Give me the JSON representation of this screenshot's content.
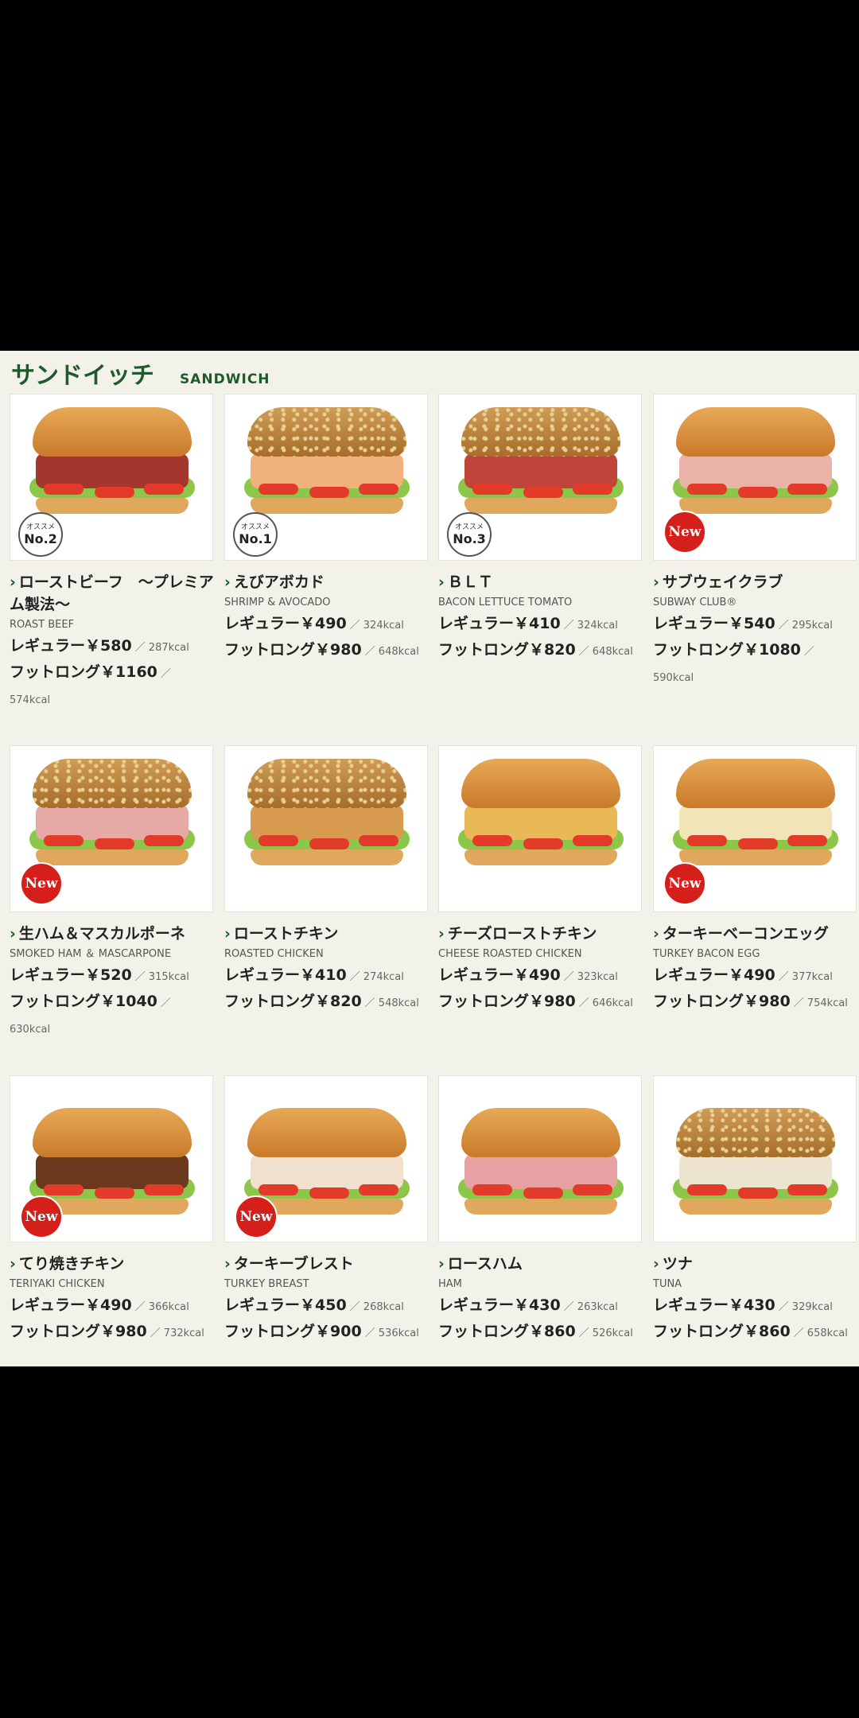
{
  "header": {
    "title_jp": "サンドイッチ",
    "title_en": "SANDWICH"
  },
  "colors": {
    "accent": "#1f5a2c",
    "new_badge": "#d51f1a",
    "background": "#f3f2ea"
  },
  "items": [
    {
      "name": "ローストビーフ　～プレミアム製法～",
      "en": "ROAST BEEF",
      "regular": "レギュラー￥580",
      "regular_cal": "／ 287kcal",
      "footlong": "フットロング￥1160",
      "footlong_cal": "／ 574kcal",
      "badge": "No.2"
    },
    {
      "name": "えびアボカド",
      "en": "SHRIMP & AVOCADO",
      "regular": "レギュラー￥490",
      "regular_cal": "／ 324kcal",
      "footlong": "フットロング￥980",
      "footlong_cal": "／ 648kcal",
      "badge": "No.1"
    },
    {
      "name": "ＢＬＴ",
      "en": "BACON LETTUCE TOMATO",
      "regular": "レギュラー￥410",
      "regular_cal": "／ 324kcal",
      "footlong": "フットロング￥820",
      "footlong_cal": "／ 648kcal",
      "badge": "No.3"
    },
    {
      "name": "サブウェイクラブ",
      "en": "SUBWAY CLUB®",
      "regular": "レギュラー￥540",
      "regular_cal": "／ 295kcal",
      "footlong": "フットロング￥1080",
      "footlong_cal": "／ 590kcal",
      "badge": "New"
    },
    {
      "name": "生ハム＆マスカルポーネ",
      "en": "SMOKED HAM ＆ MASCARPONE",
      "regular": "レギュラー￥520",
      "regular_cal": "／ 315kcal",
      "footlong": "フットロング￥1040",
      "footlong_cal": "／ 630kcal",
      "badge": "New"
    },
    {
      "name": "ローストチキン",
      "en": "ROASTED CHICKEN",
      "regular": "レギュラー￥410",
      "regular_cal": "／ 274kcal",
      "footlong": "フットロング￥820",
      "footlong_cal": "／ 548kcal",
      "badge": ""
    },
    {
      "name": "チーズローストチキン",
      "en": "CHEESE ROASTED CHICKEN",
      "regular": "レギュラー￥490",
      "regular_cal": "／ 323kcal",
      "footlong": "フットロング￥980",
      "footlong_cal": "／ 646kcal",
      "badge": ""
    },
    {
      "name": "ターキーベーコンエッグ",
      "en": "TURKEY BACON EGG",
      "regular": "レギュラー￥490",
      "regular_cal": "／ 377kcal",
      "footlong": "フットロング￥980",
      "footlong_cal": "／ 754kcal",
      "badge": "New"
    },
    {
      "name": "てり焼きチキン",
      "en": "TERIYAKI CHICKEN",
      "regular": "レギュラー￥490",
      "regular_cal": "／ 366kcal",
      "footlong": "フットロング￥980",
      "footlong_cal": "／ 732kcal",
      "badge": "New"
    },
    {
      "name": "ターキーブレスト",
      "en": "TURKEY BREAST",
      "regular": "レギュラー￥450",
      "regular_cal": "／ 268kcal",
      "footlong": "フットロング￥900",
      "footlong_cal": "／ 536kcal",
      "badge": "New"
    },
    {
      "name": "ロースハム",
      "en": "HAM",
      "regular": "レギュラー￥430",
      "regular_cal": "／ 263kcal",
      "footlong": "フットロング￥860",
      "footlong_cal": "／ 526kcal",
      "badge": ""
    },
    {
      "name": "ツナ",
      "en": "TUNA",
      "regular": "レギュラー￥430",
      "regular_cal": "／ 329kcal",
      "footlong": "フットロング￥860",
      "footlong_cal": "／ 658kcal",
      "badge": ""
    }
  ],
  "rank_badge_label": "オススメ"
}
